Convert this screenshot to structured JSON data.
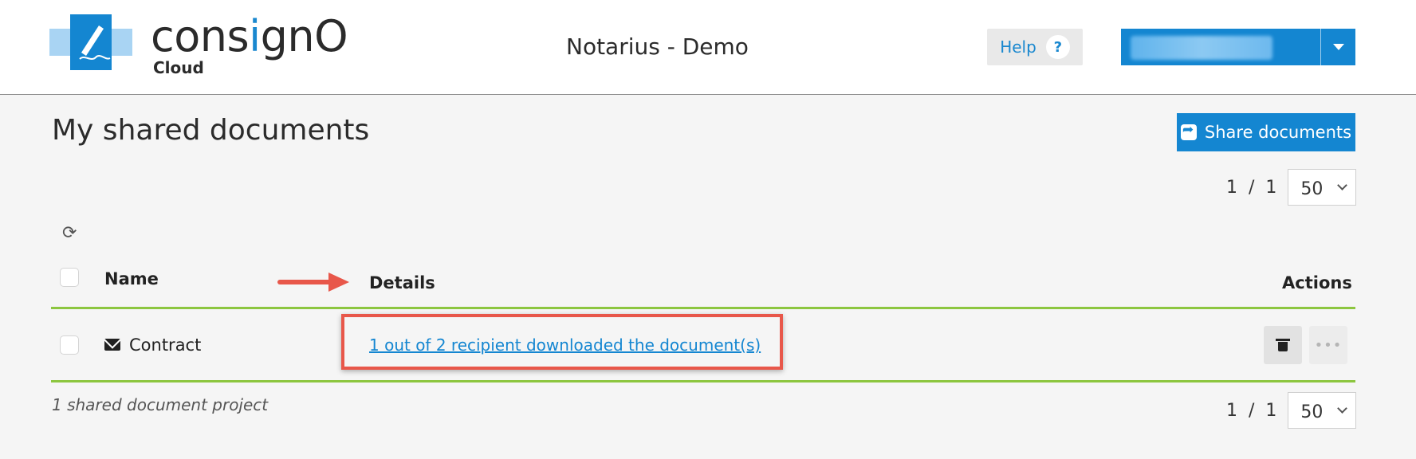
{
  "header": {
    "brand_prefix": "cons",
    "brand_i": "i",
    "brand_suffix": "gnO",
    "brand_sub": "Cloud",
    "app_title": "Notarius - Demo",
    "help_label": "Help",
    "help_icon": "?"
  },
  "main": {
    "title": "My shared documents",
    "share_label": "Share documents",
    "pager_top": {
      "text": "1  /  1",
      "per_page": "50"
    },
    "pager_bottom": {
      "text": "1  /  1",
      "per_page": "50"
    },
    "columns": {
      "name": "Name",
      "details": "Details",
      "actions": "Actions"
    },
    "rows": [
      {
        "name": "Contract",
        "details": "1 out of 2 recipient downloaded the document(s)",
        "more": "•••"
      }
    ],
    "footer_count": "1 shared document project"
  },
  "colors": {
    "accent": "#1486d1",
    "table_rule": "#8cc63f",
    "annotation": "#e8574a"
  },
  "icons": {
    "refresh": "refresh-icon",
    "mail": "envelope-icon",
    "trash": "trash-icon",
    "more": "ellipsis-icon",
    "share": "share-icon"
  }
}
